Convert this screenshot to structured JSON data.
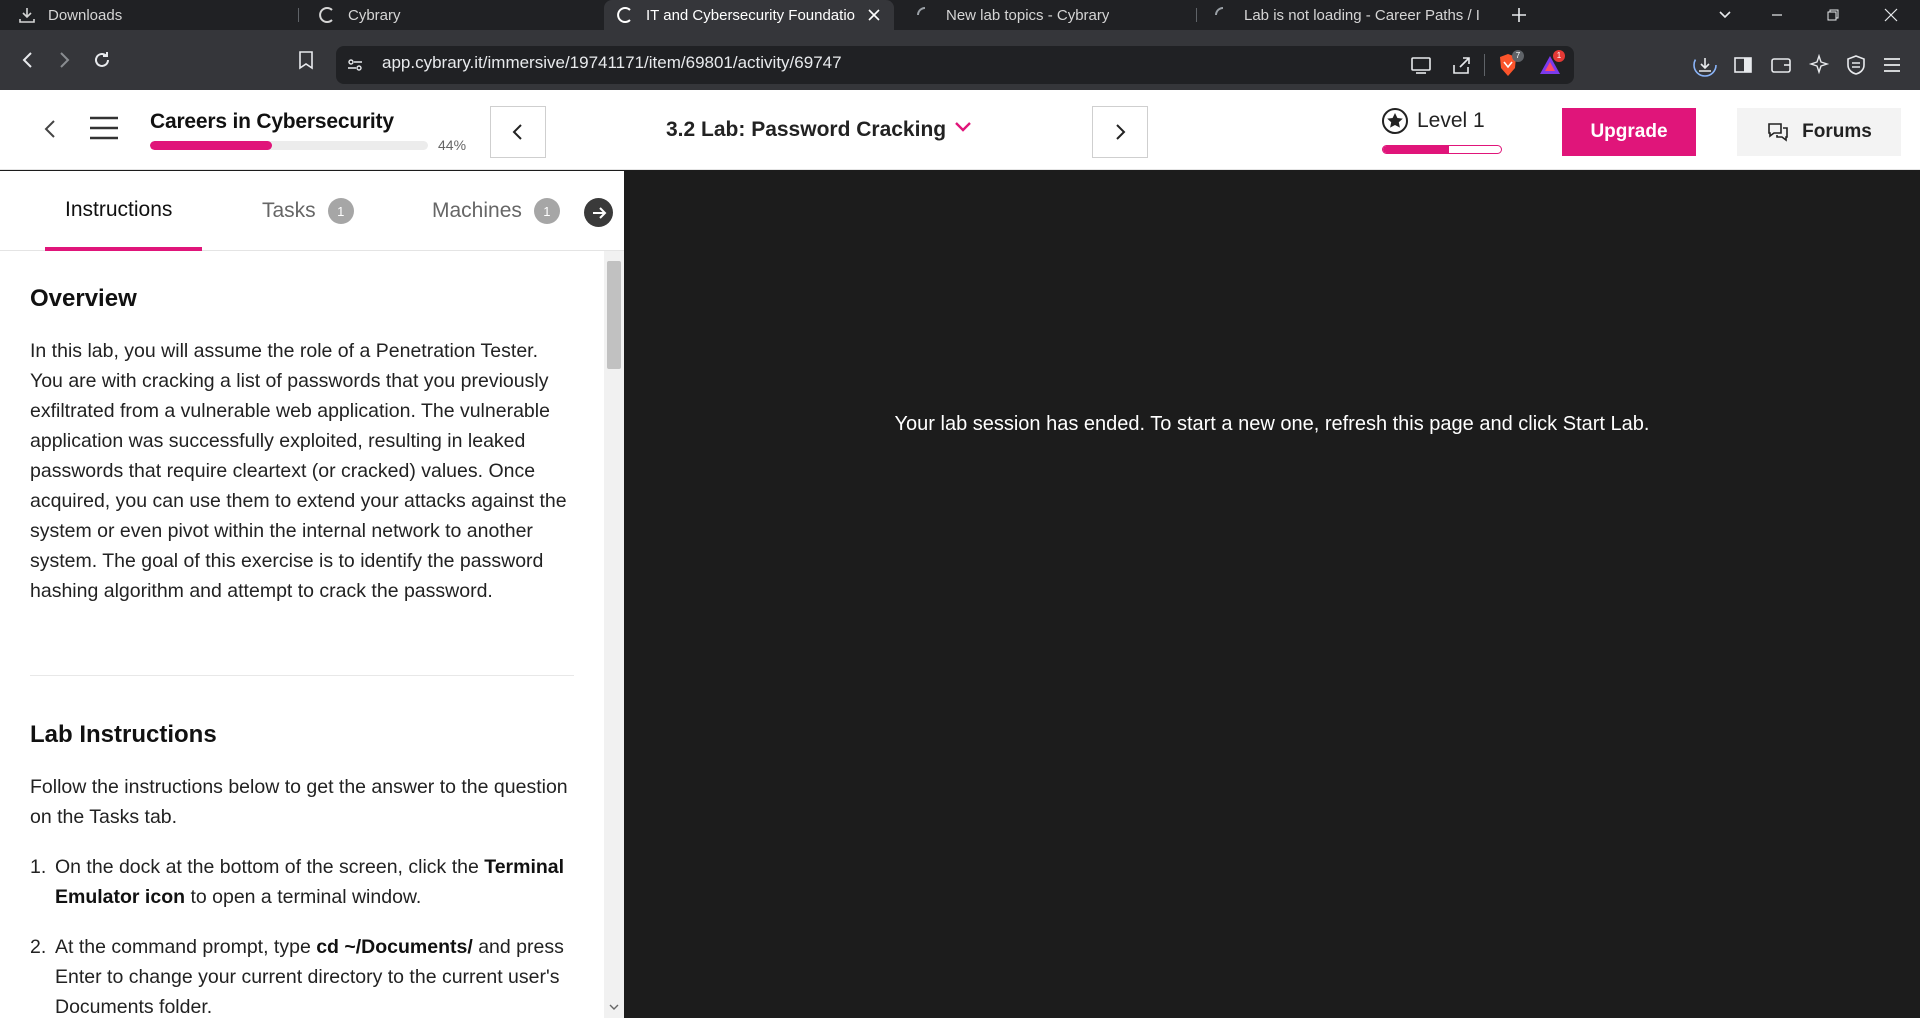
{
  "browser": {
    "tabs": [
      {
        "label": "Downloads",
        "icon": "download-icon"
      },
      {
        "label": "Cybrary",
        "icon": "cybrary-icon"
      },
      {
        "label": "IT and Cybersecurity Foundatio",
        "icon": "cybrary-icon",
        "active": true
      },
      {
        "label": "New lab topics - Cybrary",
        "icon": "loading-icon"
      },
      {
        "label": "Lab is not loading - Career Paths / I",
        "icon": "loading-icon"
      }
    ],
    "url": "app.cybrary.it/immersive/19741171/item/69801/activity/69747",
    "brave_badge": "7",
    "alert_badge": "1"
  },
  "header": {
    "course_title": "Careers in Cybersecurity",
    "progress_percent_label": "44%",
    "progress_value": 0.44,
    "lab_title": "3.2 Lab: Password Cracking",
    "level_label": "Level 1",
    "level_progress": 0.56,
    "upgrade_label": "Upgrade",
    "forums_label": "Forums"
  },
  "left_panel": {
    "tabs": [
      {
        "label": "Instructions"
      },
      {
        "label": "Tasks",
        "count": "1"
      },
      {
        "label": "Machines",
        "count": "1"
      }
    ],
    "overview_heading": "Overview",
    "overview_text": "In this lab, you will assume the role of a Penetration Tester. You are with cracking a list of passwords that you previously exfiltrated from a vulnerable web application. The vulnerable application was successfully exploited, resulting in leaked passwords that require cleartext (or cracked) values. Once acquired, you can use them to extend your attacks against the system or even pivot within the internal network to another system. The goal of this exercise is to identify the password hashing algorithm and attempt to crack the password.",
    "lab_instructions_heading": "Lab Instructions",
    "lab_instructions_intro": "Follow the instructions below to get the answer to the question on the Tasks tab.",
    "steps": [
      {
        "num": "1.",
        "pre": "On the dock at the bottom of the screen, click the ",
        "bold": "Terminal Emulator icon",
        "post": " to open a terminal window."
      },
      {
        "num": "2.",
        "pre": "At the command prompt, type ",
        "bold": "cd ~/Documents/",
        "post": " and press Enter to change your current directory to the current user's Documents folder."
      }
    ]
  },
  "right_panel": {
    "message": "Your lab session has ended. To start a new one, refresh this page and click Start Lab."
  },
  "colors": {
    "accent": "#e0157a",
    "browser_dark": "#202124",
    "browser_toolbar": "#35363a",
    "lab_bg": "#1c1c1c"
  }
}
